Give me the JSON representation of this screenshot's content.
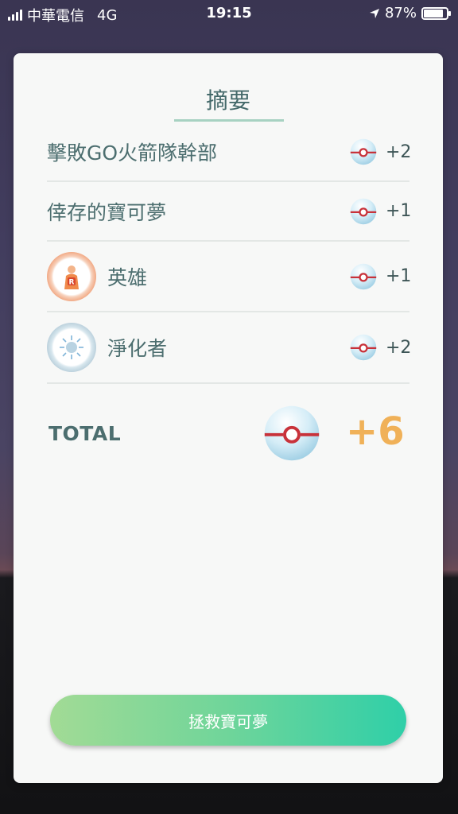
{
  "status_bar": {
    "carrier": "中華電信",
    "network": "4G",
    "time": "19:15",
    "battery": "87%",
    "battery_level": 0.87
  },
  "summary": {
    "title": "摘要",
    "rows": [
      {
        "label": "擊敗GO火箭隊幹部",
        "reward": "+2",
        "icon": "poke-ball-icon"
      },
      {
        "label": "倖存的寶可夢",
        "reward": "+1",
        "icon": "poke-ball-icon"
      },
      {
        "label": "英雄",
        "reward": "+1",
        "icon": "poke-ball-icon",
        "badge": "hero-medal-icon"
      },
      {
        "label": "淨化者",
        "reward": "+2",
        "icon": "poke-ball-icon",
        "badge": "purifier-medal-icon"
      }
    ],
    "total_label": "TOTAL",
    "total_value": "+6",
    "total_color": "#f0b158"
  },
  "actions": {
    "rescue_label": "拯救寶可夢"
  }
}
